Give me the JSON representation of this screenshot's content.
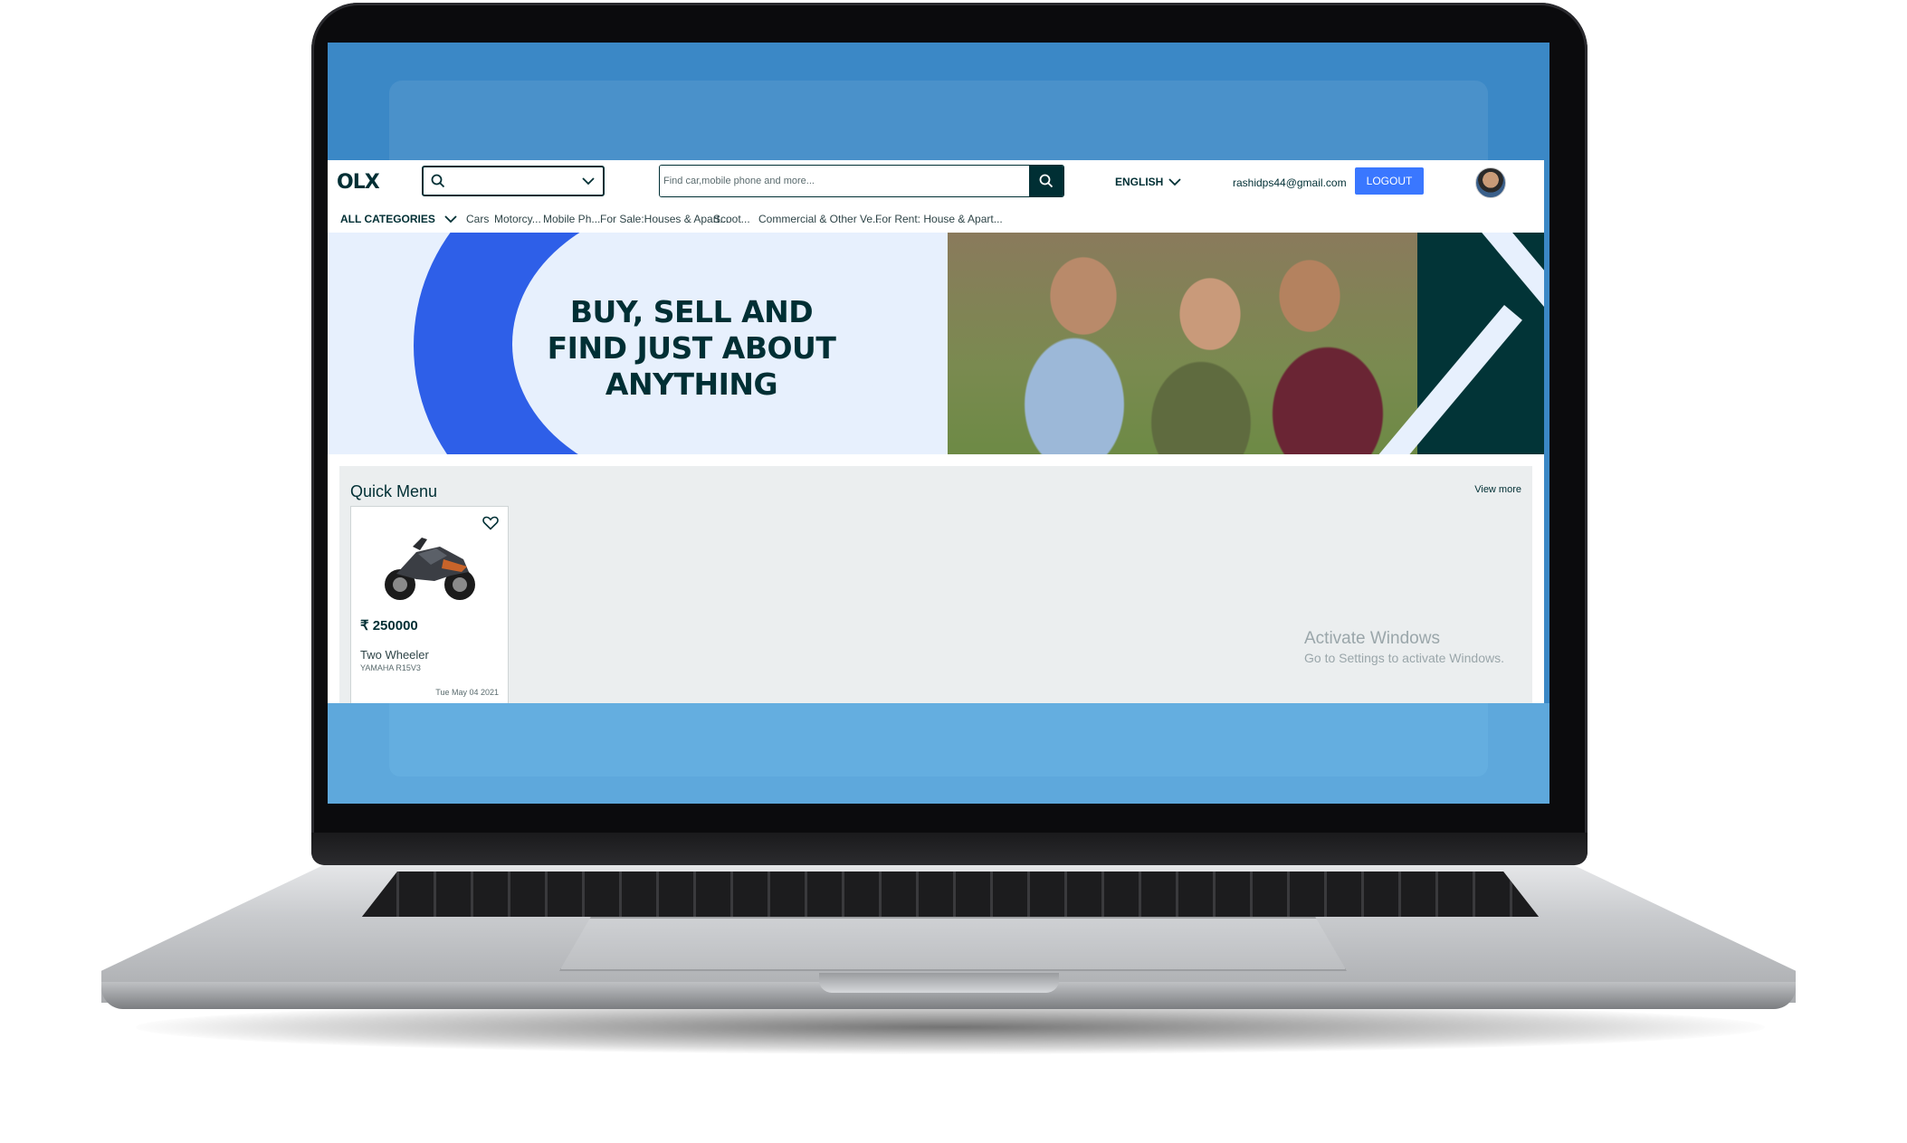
{
  "header": {
    "logo_text": "OLX",
    "search_placeholder": "Find car,mobile phone and more...",
    "language": "ENGLISH",
    "user_email": "rashidps44@gmail.com",
    "logout_label": "LOGOUT"
  },
  "categories": {
    "all_label": "ALL CATEGORIES",
    "items": [
      "Cars",
      "Motorcy...",
      "Mobile Ph...",
      "For Sale:Houses & Apart...",
      "Scoot...",
      "Commercial & Other Ve...",
      "For Rent: House & Apart..."
    ]
  },
  "banner": {
    "line1": "BUY, SELL AND",
    "line2": "FIND JUST ABOUT",
    "line3": "ANYTHING"
  },
  "quick_menu": {
    "title": "Quick Menu",
    "view_more": "View more",
    "cards": [
      {
        "price": "₹ 250000",
        "title": "Two Wheeler",
        "subtitle": "YAMAHA R15V3",
        "date": "Tue May 04 2021"
      }
    ]
  },
  "watermark": {
    "line1": "Activate Windows",
    "line2": "Go to Settings to activate Windows."
  },
  "colors": {
    "brand_dark": "#002f34",
    "logout_blue": "#3a77ff",
    "banner_blue": "#2e5fe8"
  }
}
